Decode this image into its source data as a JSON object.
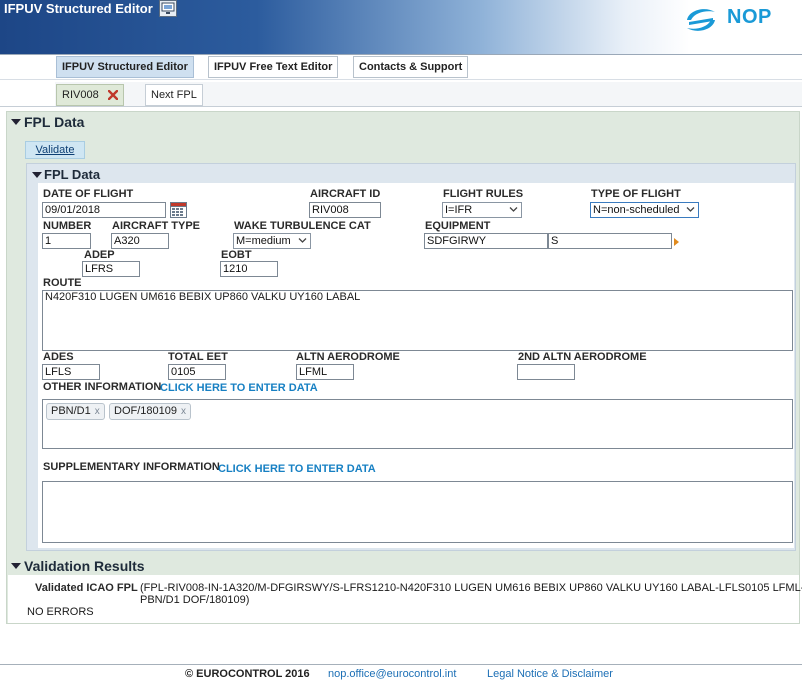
{
  "header": {
    "title": "IFPUV Structured Editor",
    "logo_text": "NOP",
    "colors": {
      "logo": "#1a9ad7",
      "header_dark": "#1d4686"
    }
  },
  "main_tabs": [
    {
      "label": "IFPUV Structured Editor",
      "active": true
    },
    {
      "label": "IFPUV Free Text Editor",
      "active": false
    },
    {
      "label": "Contacts & Support",
      "active": false
    }
  ],
  "fpl_tabs": [
    {
      "label": "RIV008",
      "active": true
    },
    {
      "label": "Next FPL",
      "active": false
    }
  ],
  "fpl_panel": {
    "title": "FPL Data",
    "validate_label": "Validate",
    "inner_title": "FPL Data"
  },
  "form": {
    "date_of_flight": {
      "label": "DATE OF FLIGHT",
      "value": "09/01/2018"
    },
    "aircraft_id": {
      "label": "AIRCRAFT ID",
      "value": "RIV008"
    },
    "flight_rules": {
      "label": "FLIGHT RULES",
      "value": "I=IFR"
    },
    "type_of_flight": {
      "label": "TYPE OF FLIGHT",
      "value": "N=non-scheduled"
    },
    "number": {
      "label": "NUMBER",
      "value": "1"
    },
    "aircraft_type": {
      "label": "AIRCRAFT TYPE",
      "value": "A320"
    },
    "wake_turbulence": {
      "label": "WAKE TURBULENCE CAT",
      "value": "M=medium"
    },
    "equipment": {
      "label": "EQUIPMENT",
      "value1": "SDFGIRWY",
      "value2": "S"
    },
    "adep": {
      "label": "ADEP",
      "value": "LFRS"
    },
    "eobt": {
      "label": "EOBT",
      "value": "1210"
    },
    "route": {
      "label": "ROUTE",
      "value": "N420F310 LUGEN UM616 BEBIX UP860 VALKU UY160 LABAL"
    },
    "ades": {
      "label": "ADES",
      "value": "LFLS"
    },
    "total_eet": {
      "label": "TOTAL EET",
      "value": "0105"
    },
    "altn_aerodrome": {
      "label": "ALTN AERODROME",
      "value": "LFML"
    },
    "altn2_aerodrome": {
      "label": "2ND ALTN AERODROME",
      "value": ""
    },
    "other_info": {
      "label": "OTHER INFORMATION",
      "link": "CLICK HERE TO ENTER DATA",
      "chips": [
        "PBN/D1",
        "DOF/180109"
      ],
      "chip_close": "x"
    },
    "supplementary_info": {
      "label": "SUPPLEMENTARY INFORMATION",
      "link": "CLICK HERE TO ENTER DATA"
    }
  },
  "validation": {
    "title": "Validation Results",
    "icao_label": "Validated ICAO FPL",
    "icao_line1": "(FPL-RIV008-IN-1A320/M-DFGIRSWY/S-LFRS1210-N420F310 LUGEN UM616 BEBIX UP860 VALKU UY160 LABAL-LFLS0105 LFML-",
    "icao_line2": "PBN/D1 DOF/180109)",
    "status": "NO ERRORS"
  },
  "footer": {
    "copyright": "© EUROCONTROL 2016",
    "email": "nop.office@eurocontrol.int",
    "legal": "Legal Notice & Disclaimer"
  }
}
